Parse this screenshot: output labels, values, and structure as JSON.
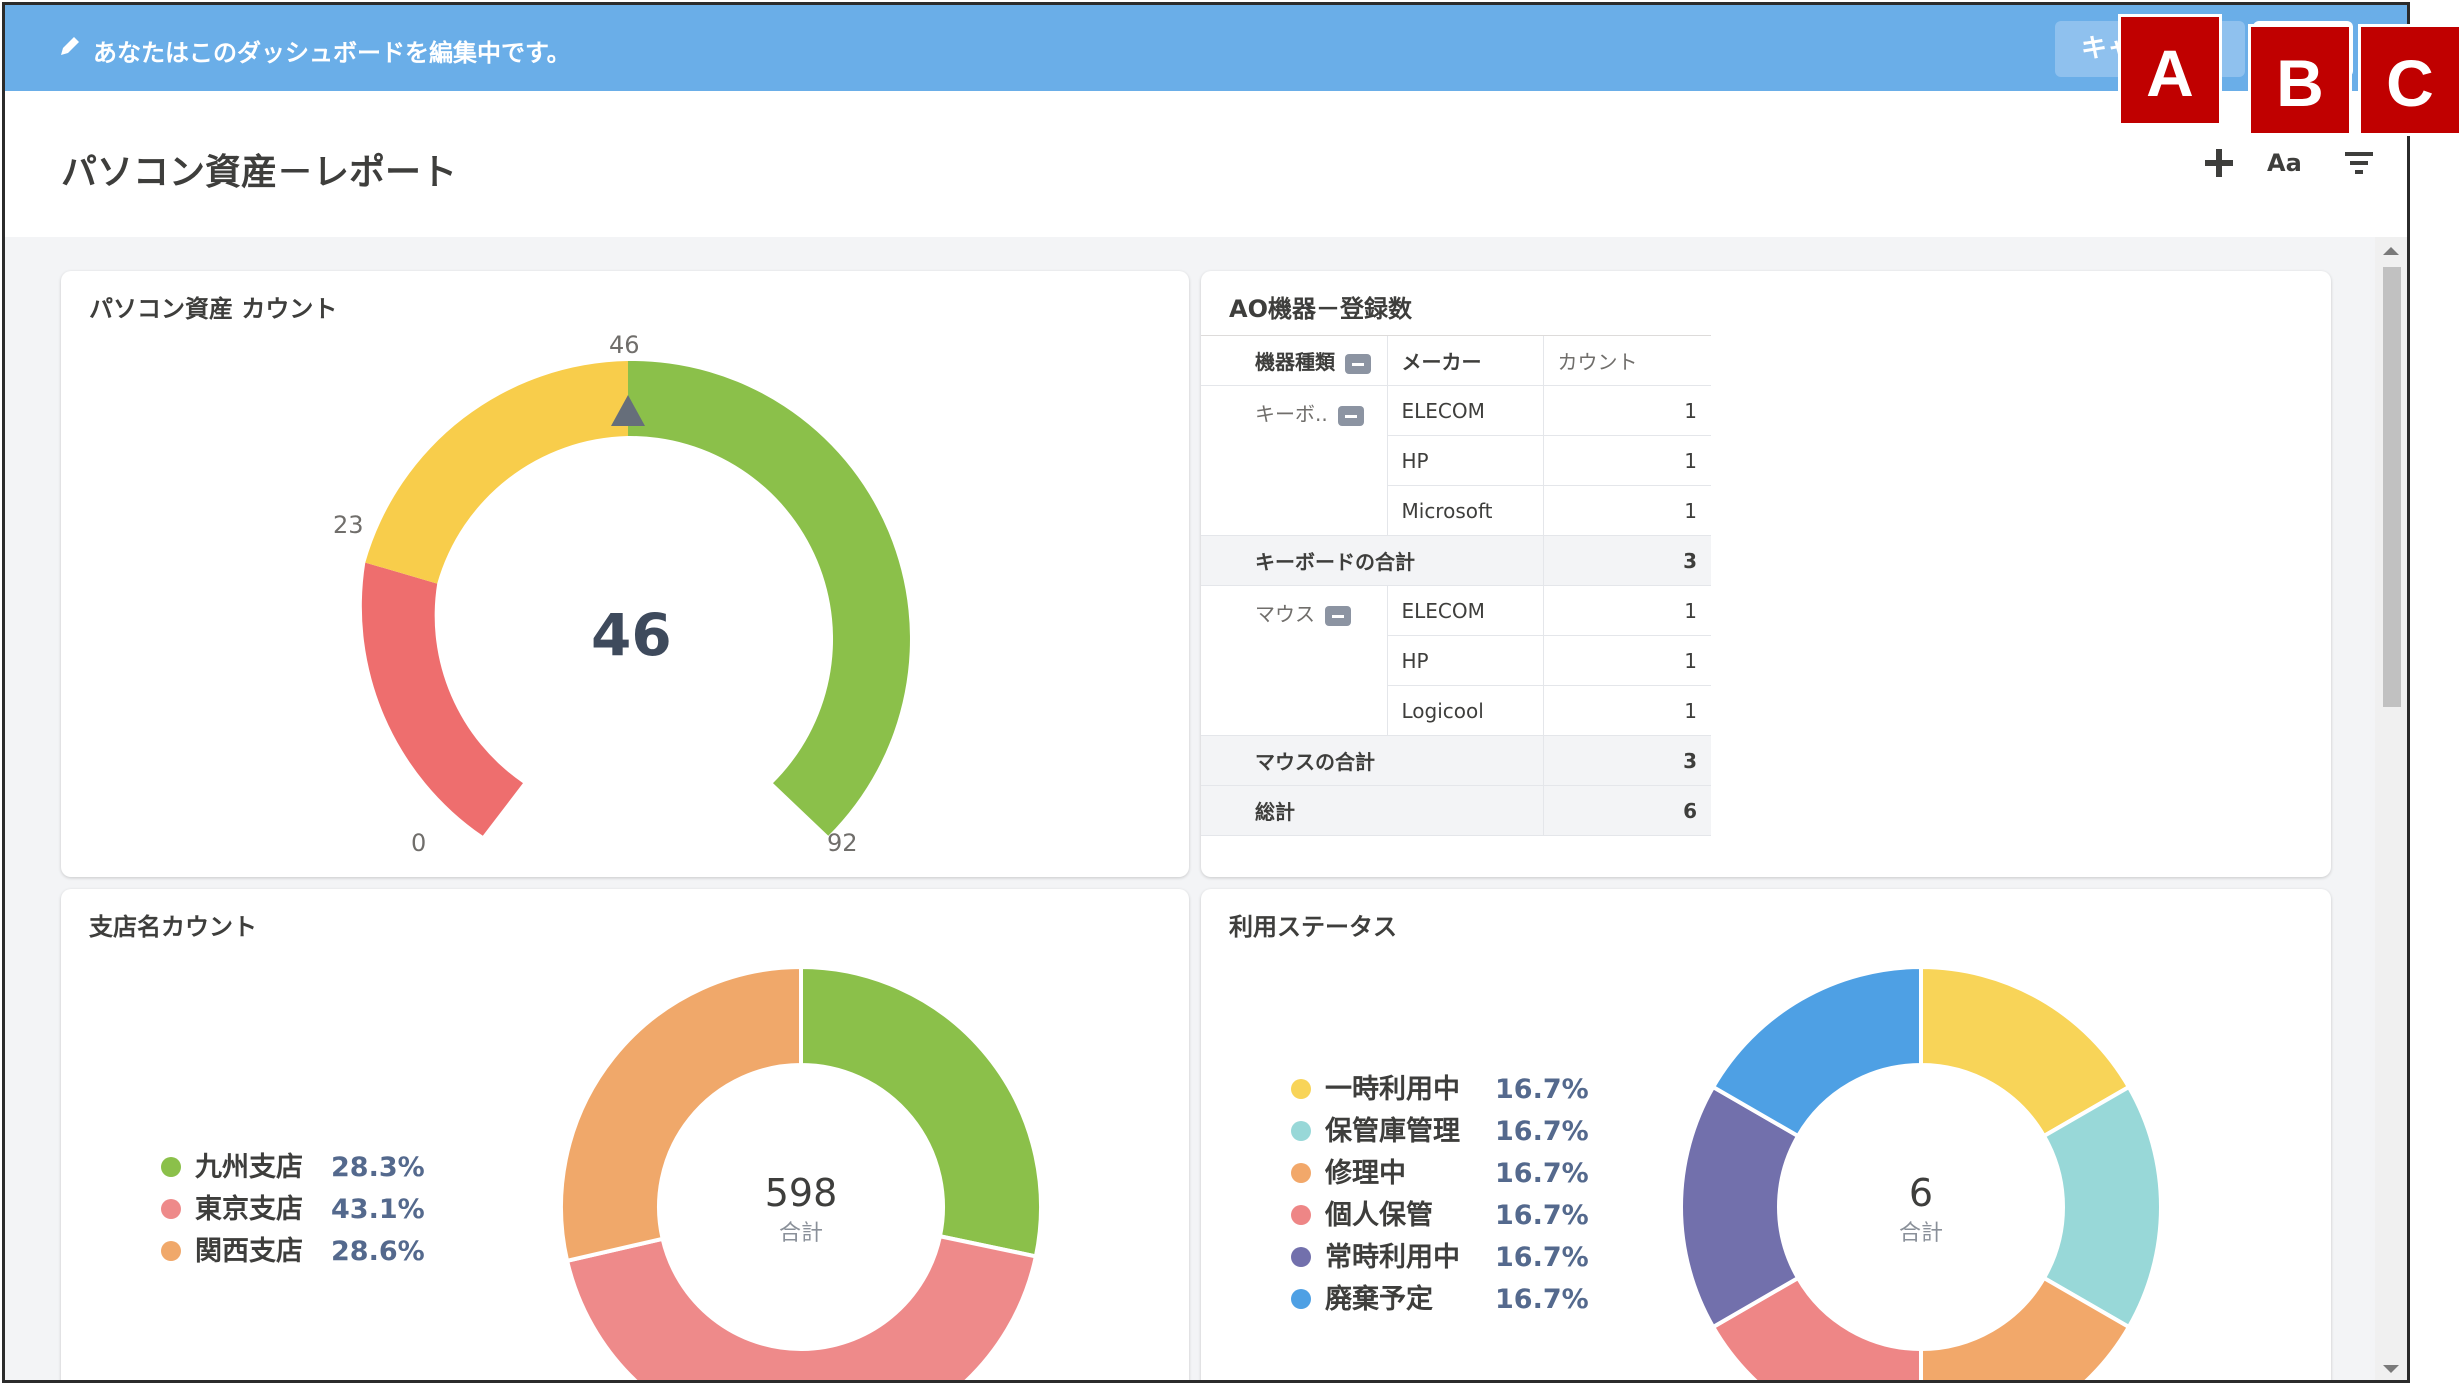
{
  "edit_bar": {
    "message": "あなたはこのダッシュボードを編集中です。",
    "cancel_label": "キャ"
  },
  "header": {
    "title": "パソコン資産－レポート",
    "icons": [
      "plus-icon",
      "text-size-icon",
      "filter-icon"
    ],
    "text_size_label": "Aa"
  },
  "badges": [
    "A",
    "B",
    "C"
  ],
  "gauge_card": {
    "title": "パソコン資産 カウント",
    "value": "46",
    "min_label": "0",
    "mid_label": "23",
    "top_label": "46",
    "max_label": "92",
    "colors": {
      "red": "#ee6e6e",
      "yellow": "#f8cd4b",
      "green": "#8bc04a"
    }
  },
  "table_card": {
    "title": "AO機器－登録数",
    "headers": [
      "機器種類",
      "メーカー",
      "カウント"
    ],
    "groups": [
      {
        "name": "キーボ..",
        "rows": [
          {
            "maker": "ELECOM",
            "count": "1"
          },
          {
            "maker": "HP",
            "count": "1"
          },
          {
            "maker": "Microsoft",
            "count": "1"
          }
        ],
        "subtotal_label": "キーボードの合計",
        "subtotal": "3"
      },
      {
        "name": "マウス",
        "rows": [
          {
            "maker": "ELECOM",
            "count": "1"
          },
          {
            "maker": "HP",
            "count": "1"
          },
          {
            "maker": "Logicool",
            "count": "1"
          }
        ],
        "subtotal_label": "マウスの合計",
        "subtotal": "3"
      }
    ],
    "total_label": "総計",
    "total": "6"
  },
  "branch_card": {
    "title": "支店名カウント",
    "total": "598",
    "total_label": "合計",
    "legend": [
      {
        "label": "九州支店",
        "pct": "28.3%",
        "color": "#8bc04a"
      },
      {
        "label": "東京支店",
        "pct": "43.1%",
        "color": "#ee8a8a"
      },
      {
        "label": "関西支店",
        "pct": "28.6%",
        "color": "#f0a86a"
      }
    ]
  },
  "status_card": {
    "title": "利用ステータス",
    "total": "6",
    "total_label": "合計",
    "legend": [
      {
        "label": "一時利用中",
        "pct": "16.7%",
        "color": "#f8d458"
      },
      {
        "label": "保管庫管理",
        "pct": "16.7%",
        "color": "#98d8d8"
      },
      {
        "label": "修理中",
        "pct": "16.7%",
        "color": "#f2a86a"
      },
      {
        "label": "個人保管",
        "pct": "16.7%",
        "color": "#ee8686"
      },
      {
        "label": "常時利用中",
        "pct": "16.7%",
        "color": "#7270ac"
      },
      {
        "label": "廃棄予定",
        "pct": "16.7%",
        "color": "#4ea0e4"
      }
    ]
  },
  "chart_data": [
    {
      "type": "gauge",
      "title": "パソコン資産 カウント",
      "value": 46,
      "range": [
        0,
        92
      ],
      "bands": [
        {
          "from": 0,
          "to": 23,
          "color": "#ee6e6e"
        },
        {
          "from": 23,
          "to": 46,
          "color": "#f8cd4b"
        },
        {
          "from": 46,
          "to": 92,
          "color": "#8bc04a"
        }
      ]
    },
    {
      "type": "pie",
      "title": "支店名カウント",
      "total": 598,
      "categories": [
        "九州支店",
        "東京支店",
        "関西支店"
      ],
      "values": [
        28.3,
        43.1,
        28.6
      ],
      "colors": [
        "#8bc04a",
        "#ee8a8a",
        "#f0a86a"
      ]
    },
    {
      "type": "pie",
      "title": "利用ステータス",
      "total": 6,
      "categories": [
        "一時利用中",
        "保管庫管理",
        "修理中",
        "個人保管",
        "常時利用中",
        "廃棄予定"
      ],
      "values": [
        16.7,
        16.7,
        16.7,
        16.7,
        16.7,
        16.7
      ],
      "colors": [
        "#f8d458",
        "#98d8d8",
        "#f2a86a",
        "#ee8686",
        "#7270ac",
        "#4ea0e4"
      ]
    }
  ]
}
